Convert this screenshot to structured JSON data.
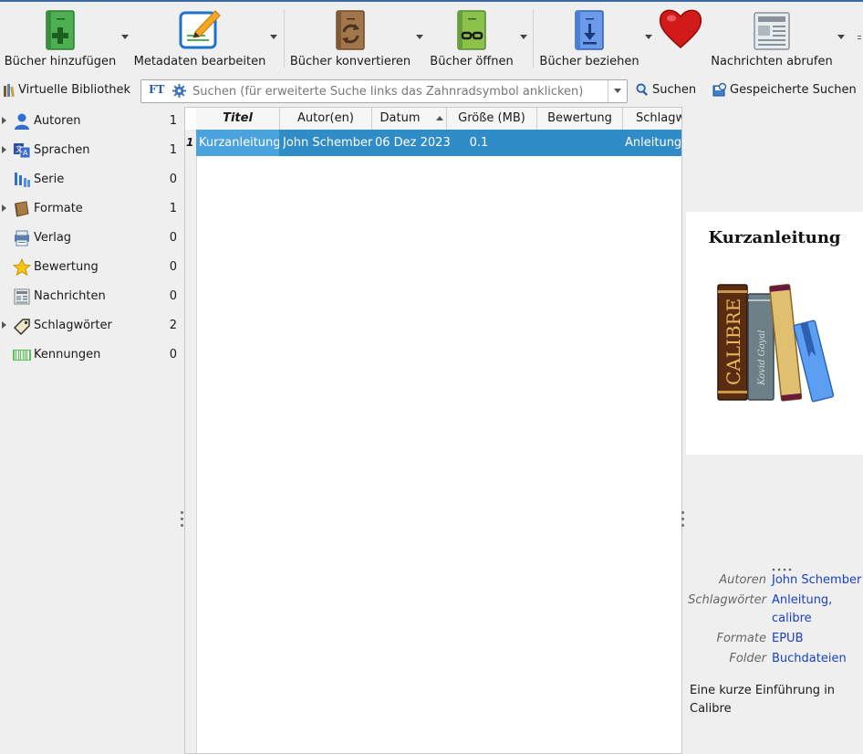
{
  "toolbar": {
    "add_books": "Bücher hinzufügen",
    "edit_metadata": "Metadaten bearbeiten",
    "convert_books": "Bücher konvertieren",
    "view_books": "Bücher öffnen",
    "get_books": "Bücher beziehen",
    "fetch_news": "Nachrichten abrufen"
  },
  "search": {
    "virtual_library": "Virtuelle Bibliothek",
    "placeholder": "Suchen (für erweiterte Suche links das Zahnradsymbol anklicken)",
    "ft_label": "FT",
    "search_button": "Suchen",
    "saved_searches": "Gespeicherte Suchen"
  },
  "tag_browser": {
    "items": [
      {
        "name": "Autoren",
        "count": "1",
        "expandable": true,
        "icon": "user-icon"
      },
      {
        "name": "Sprachen",
        "count": "1",
        "expandable": true,
        "icon": "languages-icon"
      },
      {
        "name": "Serie",
        "count": "0",
        "expandable": false,
        "icon": "series-icon"
      },
      {
        "name": "Formate",
        "count": "1",
        "expandable": true,
        "icon": "book-format-icon"
      },
      {
        "name": "Verlag",
        "count": "0",
        "expandable": false,
        "icon": "publisher-icon"
      },
      {
        "name": "Bewertung",
        "count": "0",
        "expandable": false,
        "icon": "star-icon"
      },
      {
        "name": "Nachrichten",
        "count": "0",
        "expandable": false,
        "icon": "news-icon"
      },
      {
        "name": "Schlagwörter",
        "count": "2",
        "expandable": true,
        "icon": "tag-icon"
      },
      {
        "name": "Kennungen",
        "count": "0",
        "expandable": false,
        "icon": "barcode-icon"
      }
    ]
  },
  "book_list": {
    "columns": [
      "Titel",
      "Autor(en)",
      "Datum",
      "Größe (MB)",
      "Bewertung",
      "Schlagw"
    ],
    "rows": [
      {
        "num": "1",
        "title": "Kurzanleitung",
        "author": "John Schember",
        "date": "06 Dez 2023",
        "size": "0.1",
        "rating": "",
        "tags": "Anleitung,"
      }
    ]
  },
  "details": {
    "cover_title": "Kurzanleitung",
    "cover_spine_1": "CALIBRE",
    "cover_spine_2": "Kovid Goyal",
    "labels": {
      "authors": "Autoren",
      "tags": "Schlagwörter",
      "formats": "Formate",
      "folder": "Folder"
    },
    "authors": "John Schember",
    "tags_line1": "Anleitung,",
    "tags_line2": "calibre",
    "formats": "EPUB",
    "folder": "Buchdateien",
    "comment": "Eine kurze Einführung in Calibre"
  },
  "colors": {
    "selection": "#308cc6",
    "link": "#1a3fc7",
    "accent": "#3d6aa0"
  }
}
